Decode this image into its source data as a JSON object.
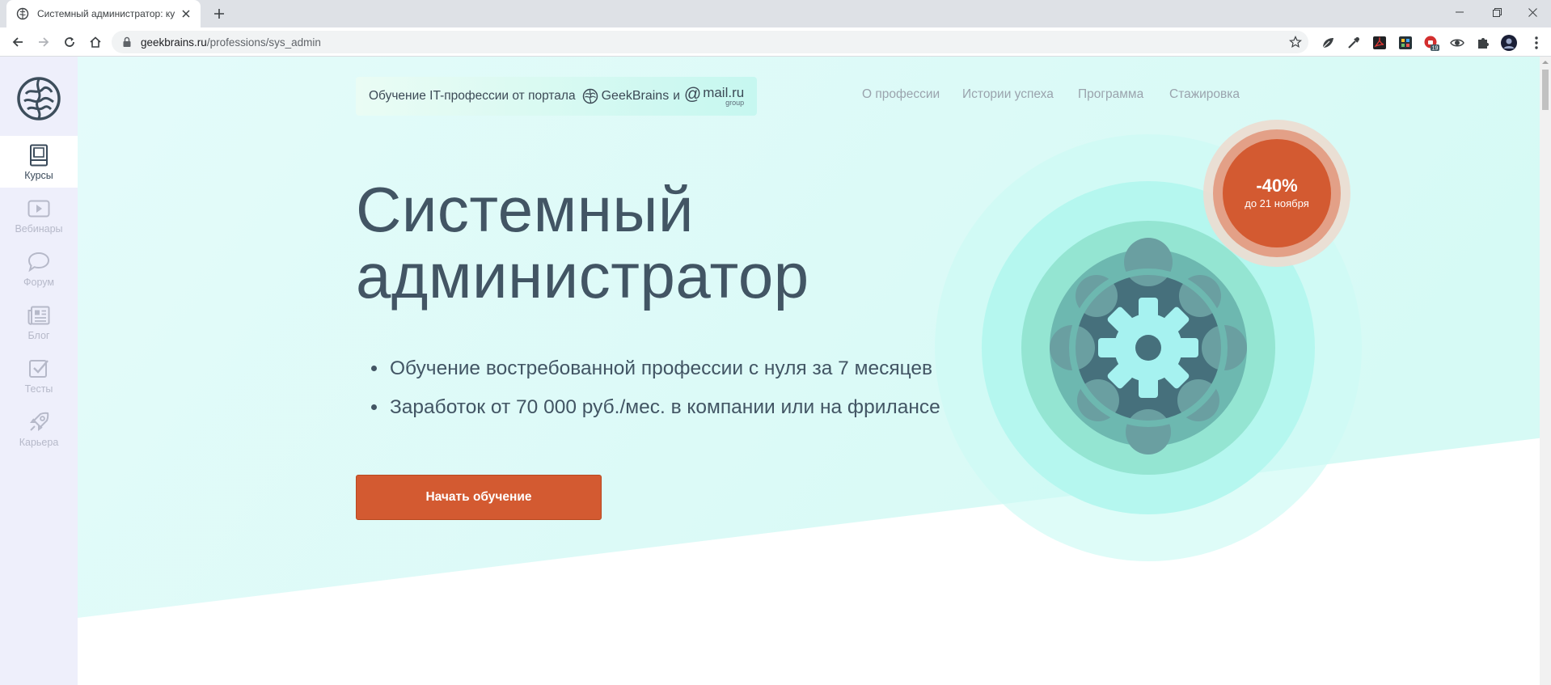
{
  "browser": {
    "tab_title": "Системный администратор: курс",
    "url_host": "geekbrains.ru",
    "url_path": "/professions/sys_admin",
    "extension_badge": "19"
  },
  "sidebar": {
    "items": [
      {
        "label": "Курсы",
        "icon": "book-icon",
        "active": true
      },
      {
        "label": "Вебинары",
        "icon": "play-icon",
        "active": false
      },
      {
        "label": "Форум",
        "icon": "speech-bubble-icon",
        "active": false
      },
      {
        "label": "Блог",
        "icon": "newspaper-icon",
        "active": false
      },
      {
        "label": "Тесты",
        "icon": "checkbox-icon",
        "active": false
      },
      {
        "label": "Карьера",
        "icon": "rocket-icon",
        "active": false
      }
    ]
  },
  "header": {
    "portal_text": "Обучение IT-профессии от портала",
    "geekbrains": "GeekBrains",
    "and": "и",
    "mailru_at": "@",
    "mailru": "mail.ru",
    "mailru_group": "group",
    "nav": [
      "О профессии",
      "Истории успеха",
      "Программа",
      "Стажировка"
    ]
  },
  "hero": {
    "title_line1": "Системный",
    "title_line2": "администратор",
    "bullets": [
      "Обучение востребованной профессии с нуля за 7 месяцев",
      "Заработок от 70 000 руб./мес. в компании или на фрилансе"
    ],
    "cta_label": "Начать обучение"
  },
  "discount": {
    "percent": "-40%",
    "until": "до 21 ноября"
  },
  "colors": {
    "accent": "#d35a31",
    "hero_bg": "#e3fbf9",
    "sidebar_bg": "#eeeffb",
    "text": "#425564"
  }
}
